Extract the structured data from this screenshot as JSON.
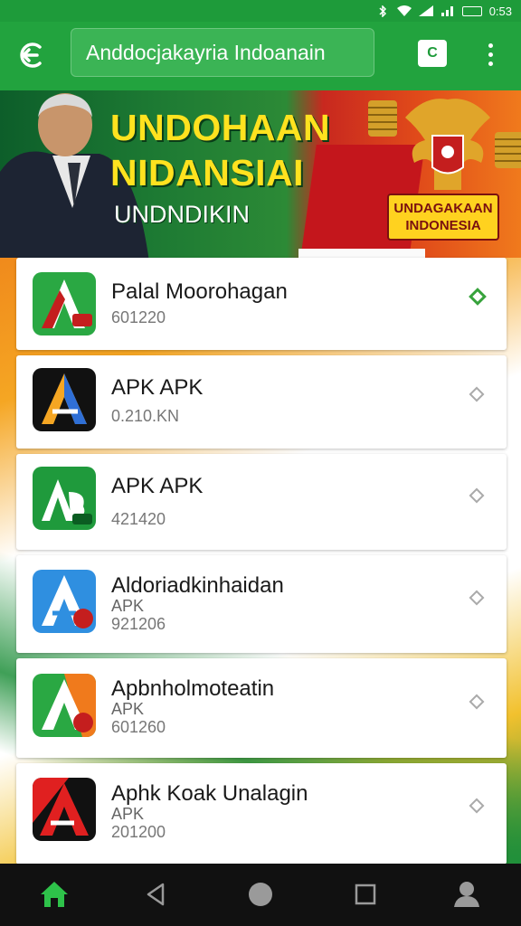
{
  "status_bar": {
    "time": "0:53"
  },
  "app_bar": {
    "url": "Anddocjakayria Indoanain",
    "tab_count": "C"
  },
  "banner": {
    "headline_1": "UNDOHAAN",
    "headline_2": "NIDANSIAI",
    "headline_3": "UNDNDIKIN",
    "badge_line_1": "UNDAGAKAAN",
    "badge_line_2": "INDONESIA"
  },
  "apps": [
    {
      "name": "Palal Moorohagan",
      "type": "",
      "meta": "601220",
      "icon": "app-icon-a-green"
    },
    {
      "name": "APK APK",
      "type": "",
      "meta": "0.210.KN",
      "icon": "app-icon-a-orange-blue"
    },
    {
      "name": "APK APK",
      "type": "",
      "meta": "421420",
      "icon": "app-icon-ab-green"
    },
    {
      "name": "Aldoriadkinhaidan",
      "type": "APK",
      "meta": "921206",
      "icon": "app-icon-a-blue"
    },
    {
      "name": "Apbnholmoteatin",
      "type": "APK",
      "meta": "601260",
      "icon": "app-icon-a-green-orange"
    },
    {
      "name": "Aphk Koak Unalagin",
      "type": "APK",
      "meta": "201200",
      "icon": "app-icon-a-red-black"
    }
  ],
  "nav": {
    "home": "home-icon",
    "back": "back-icon",
    "circle": "home-circle-icon",
    "recents": "recents-icon",
    "profile": "profile-icon"
  },
  "colors": {
    "primary": "#22a33e",
    "accent": "#37a33c",
    "banner_yellow": "#ffe21f"
  }
}
